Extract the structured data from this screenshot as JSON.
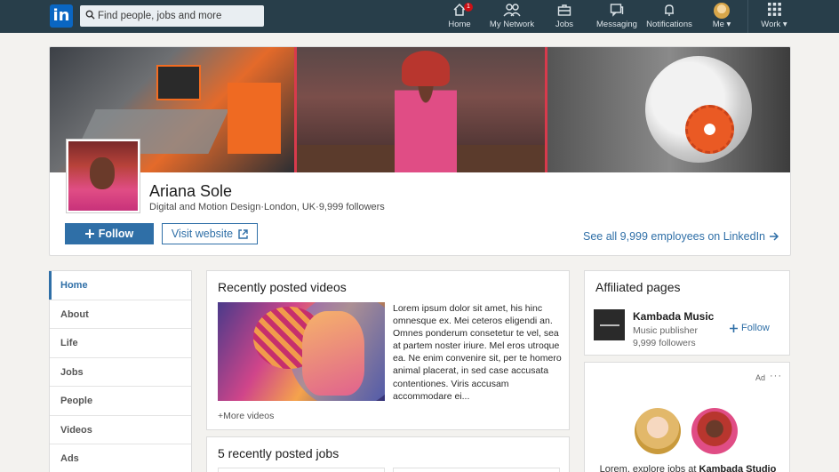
{
  "nav": {
    "logo": "in",
    "search_placeholder": "Find people, jobs and more",
    "items": [
      {
        "label": "Home",
        "icon": "home-icon",
        "badge": "1"
      },
      {
        "label": "My Network",
        "icon": "network-icon"
      },
      {
        "label": "Jobs",
        "icon": "briefcase-icon"
      },
      {
        "label": "Messaging",
        "icon": "messaging-icon"
      },
      {
        "label": "Notifications",
        "icon": "bell-icon"
      },
      {
        "label": "Me",
        "icon": "avatar"
      },
      {
        "label": "Work",
        "icon": "grid-icon"
      }
    ]
  },
  "company": {
    "name": "Ariana Sole",
    "category": "Digital and Motion Design",
    "location": "London, UK",
    "followers": "9,999 followers",
    "follow_label": "Follow",
    "visit_label": "Visit website",
    "see_all_label": "See all 9,999 employees on LinkedIn"
  },
  "menu": [
    "Home",
    "About",
    "Life",
    "Jobs",
    "People",
    "Videos",
    "Ads"
  ],
  "videos": {
    "title": "Recently posted videos",
    "description": "Lorem ipsum dolor sit amet, his hinc omnesque ex. Mei ceteros eligendi an. Omnes ponderum consetetur te vel, sea at partem noster iriure. Mel eros utroque ea. Ne enim convenire sit, per te homero animal placerat, in sed case accusata contentiones. Viris accusam accommodare ei...",
    "more_label": "+More videos"
  },
  "jobs": {
    "title": "5 recently posted jobs"
  },
  "affiliated": {
    "title": "Affiliated pages",
    "name": "Kambada Music",
    "type": "Music publisher",
    "followers": "9,999 followers",
    "follow_label": "Follow"
  },
  "ad": {
    "label": "Ad",
    "menu": "···",
    "text_prefix": "Lorem, explore jobs at",
    "text_company": "Kambada Studio"
  },
  "colors": {
    "nav_bg": "#283e4a",
    "accent": "#2f6fa7",
    "page_bg": "#f3f2ef"
  }
}
